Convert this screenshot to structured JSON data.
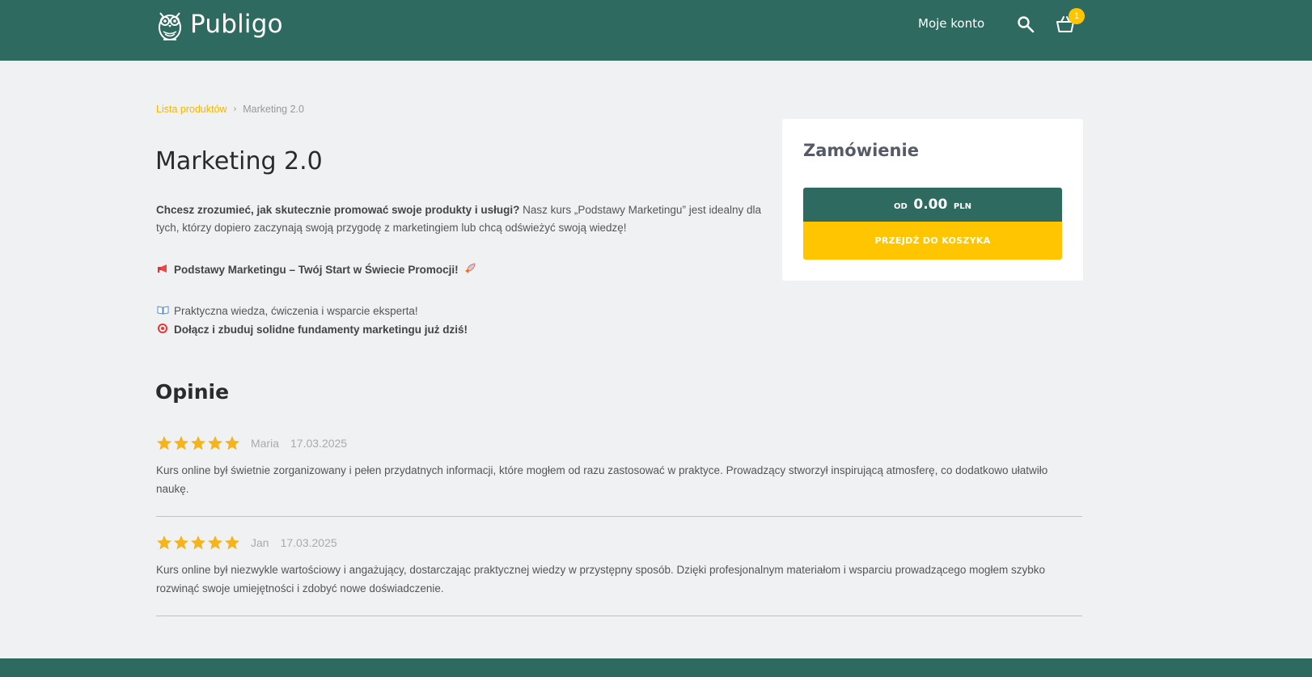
{
  "header": {
    "logo_text": "Publigo",
    "account_label": "Moje konto",
    "cart_count": "1"
  },
  "breadcrumb": {
    "link": "Lista produktów",
    "current": "Marketing 2.0"
  },
  "product": {
    "title": "Marketing 2.0",
    "desc_bold": "Chcesz zrozumieć, jak skutecznie promować swoje produkty i usługi?",
    "desc_rest": " Nasz kurs „Podstawy Marketingu” jest idealny dla tych, którzy dopiero zaczynają swoją przygodę z marketingiem lub chcą odświeżyć swoją wiedzę!",
    "headline": "Podstawy Marketingu – Twój Start w Świecie Promocji!",
    "line1": "Praktyczna wiedza, ćwiczenia i wsparcie eksperta!",
    "line2": "Dołącz i zbuduj solidne fundamenty marketingu już dziś!"
  },
  "opinions": {
    "title": "Opinie",
    "reviews": [
      {
        "name": "Maria",
        "date": "17.03.2025",
        "rating": 5,
        "text": "Kurs online był świetnie zorganizowany i pełen przydatnych informacji, które mogłem od razu zastosować w praktyce. Prowadzący stworzył inspirującą atmosferę, co dodatkowo ułatwiło naukę."
      },
      {
        "name": "Jan",
        "date": "17.03.2025",
        "rating": 5,
        "text": "Kurs online był niezwykle wartościowy i angażujący, dostarczając praktycznej wiedzy w przystępny sposób. Dzięki profesjonalnym materiałom i wsparciu prowadzącego mogłem szybko rozwinąć swoje umiejętności i zdobyć nowe doświadczenie."
      }
    ]
  },
  "order": {
    "title": "Zamówienie",
    "price_prefix": "OD",
    "price_value": "0.00",
    "price_currency": "PLN",
    "cart_button": "PRZEJDŹ DO KOSZYKA"
  },
  "colors": {
    "brand": "#2f6a60",
    "accent": "#ffc600",
    "star": "#f5b41b"
  }
}
